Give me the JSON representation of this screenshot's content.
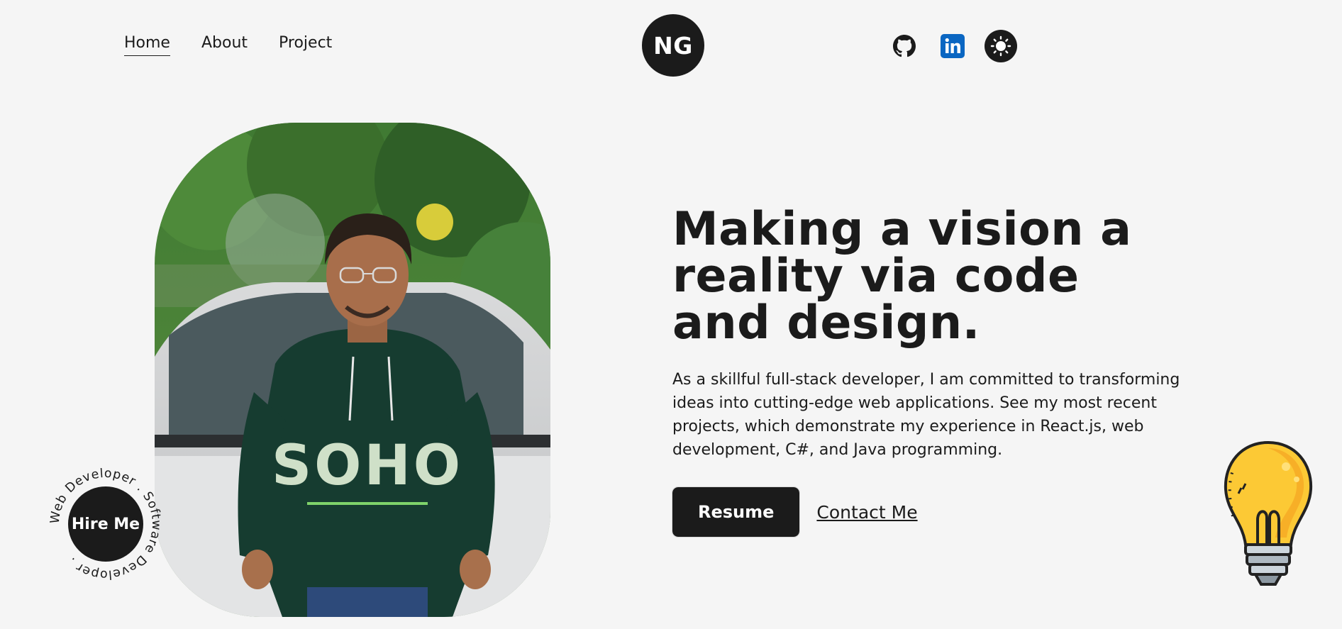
{
  "nav": {
    "items": [
      {
        "label": "Home",
        "active": true
      },
      {
        "label": "About",
        "active": false
      },
      {
        "label": "Project",
        "active": false
      }
    ]
  },
  "logo": {
    "text": "NG"
  },
  "social": {
    "github_icon": "github-icon",
    "linkedin_icon": "linkedin-icon",
    "theme_icon": "sun-icon"
  },
  "hero": {
    "title": "Making a vision a reality via code and design.",
    "description": "As a skillful full-stack developer, I am committed to transforming ideas into cutting-edge web applications. See my most recent projects, which demonstrate my experience in React.js, web development, C#, and Java programming.",
    "resume_label": "Resume",
    "contact_label": "Contact Me"
  },
  "hire": {
    "label": "Hire Me",
    "ring_text": "Web Developer . Software Developer ."
  },
  "colors": {
    "background": "#f5f5f5",
    "primary": "#1b1b1b",
    "linkedin": "#0a66c2",
    "bulb": "#fcc935"
  }
}
